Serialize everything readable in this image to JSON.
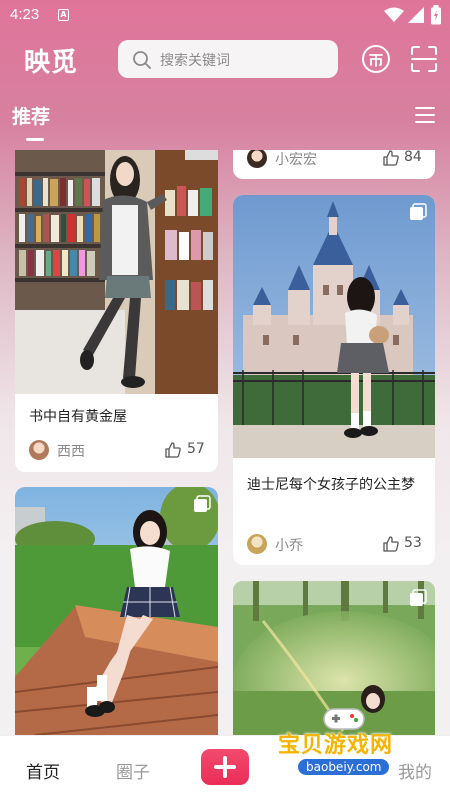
{
  "status_bar": {
    "time": "4:23",
    "sim_label": "A"
  },
  "app": {
    "logo": "映觅"
  },
  "search": {
    "placeholder": "搜索关键词"
  },
  "tabs": {
    "active": "推荐"
  },
  "feed": {
    "left_column": [
      {
        "title": "书中自有黄金屋",
        "author": "西西",
        "likes": "57"
      },
      {
        "title": "",
        "author": "",
        "likes": ""
      }
    ],
    "right_column": [
      {
        "title": "",
        "author": "小宏宏",
        "likes": "84"
      },
      {
        "title": "迪士尼每个女孩子的公主梦",
        "author": "小乔",
        "likes": "53"
      },
      {
        "title": "",
        "author": "",
        "likes": ""
      }
    ]
  },
  "bottom_nav": {
    "home": "首页",
    "circle": "圈子",
    "mine": "我的"
  },
  "watermark": {
    "text": "宝贝游戏网",
    "url": "baobeiy.com"
  },
  "colors": {
    "accent": "#e0759a",
    "add_button": "#ea2d57"
  }
}
